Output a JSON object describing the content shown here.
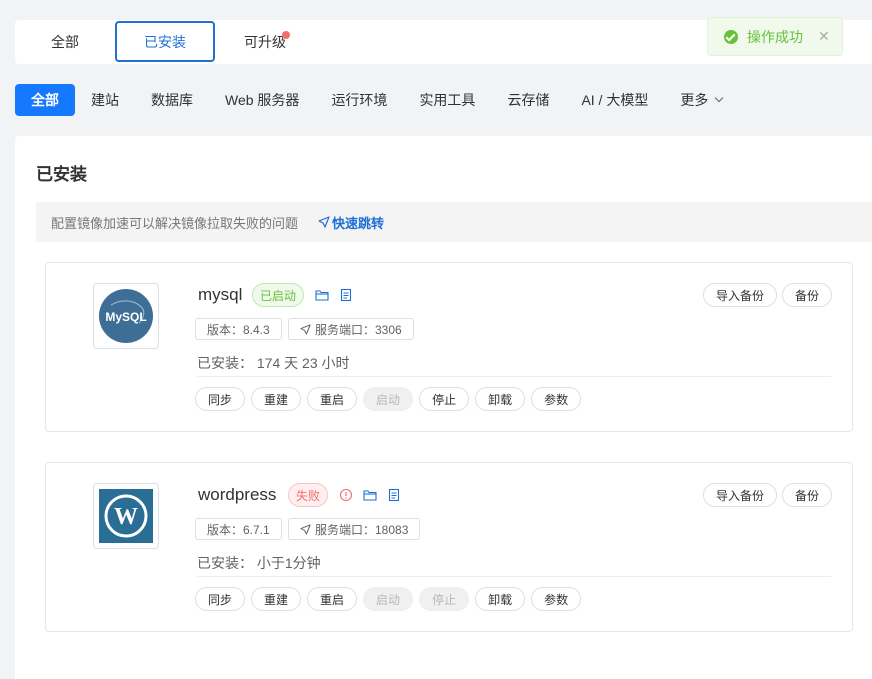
{
  "top_tabs": [
    {
      "label": "全部"
    },
    {
      "label": "已安装"
    },
    {
      "label": "可升级"
    }
  ],
  "toast": {
    "message": "操作成功"
  },
  "categories": [
    {
      "label": "全部"
    },
    {
      "label": "建站"
    },
    {
      "label": "数据库"
    },
    {
      "label": "Web 服务器"
    },
    {
      "label": "运行环境"
    },
    {
      "label": "实用工具"
    },
    {
      "label": "云存储"
    },
    {
      "label": "AI / 大模型"
    },
    {
      "label": "更多"
    }
  ],
  "panel": {
    "title": "已安装",
    "notice_text": "配置镜像加速可以解决镜像拉取失败的问题",
    "notice_link": "快速跳转"
  },
  "apps": [
    {
      "name": "mysql",
      "logo_text": "MySQL",
      "status": "已启动",
      "version": "版本：8.4.3",
      "port": "服务端口：3306",
      "installed": "已安装：  174 天 23 小时",
      "actions": [
        "同步",
        "重建",
        "重启",
        "启动",
        "停止",
        "卸载",
        "参数"
      ],
      "right_actions": [
        "导入备份",
        "备份"
      ]
    },
    {
      "name": "wordpress",
      "logo_text": "W",
      "status": "失败",
      "version": "版本：6.7.1",
      "port": "服务端口：18083",
      "installed": "已安装：  小于1分钟",
      "actions": [
        "同步",
        "重建",
        "重启",
        "启动",
        "停止",
        "卸载",
        "参数"
      ],
      "right_actions": [
        "导入备份",
        "备份"
      ]
    }
  ],
  "colors": {
    "primary": "#1677ff",
    "success": "#67c23a",
    "danger": "#f56c6c"
  }
}
